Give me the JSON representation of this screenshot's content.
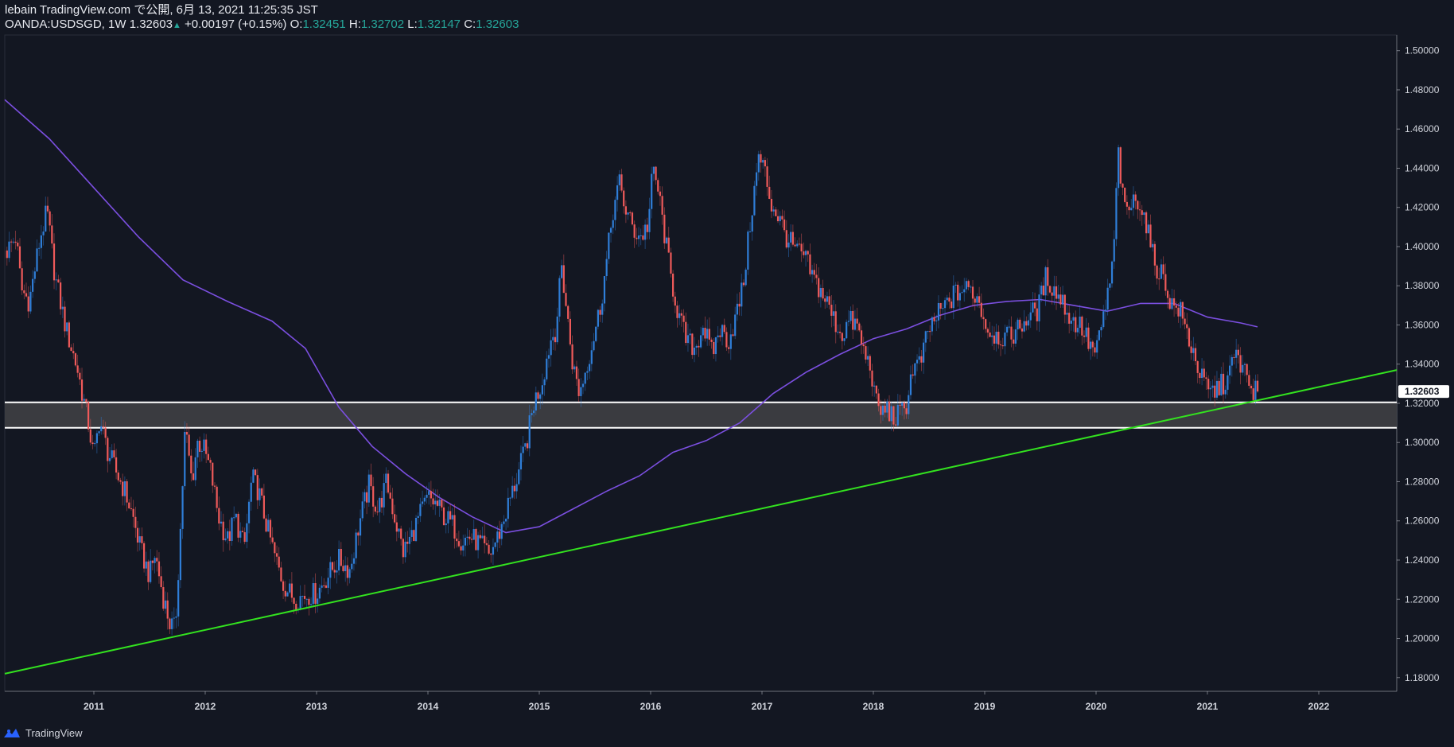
{
  "header": {
    "publish_line": "lebain TradingView.com で公開, 6月 13, 2021 11:25:35 JST",
    "symbol": "OANDA:USDSGD, 1W",
    "last": "1.32603",
    "change": "+0.00197 (+0.15%)",
    "o_label": "O:",
    "o": "1.32451",
    "h_label": "H:",
    "h": "1.32702",
    "l_label": "L:",
    "l": "1.32147",
    "c_label": "C:",
    "c": "1.32603"
  },
  "footer": {
    "brand": "TradingView",
    "icon": "tradingview-logo-icon"
  },
  "colors": {
    "background": "#131722",
    "up": "#2f7ed8",
    "down": "#ef5a5a",
    "ma": "#7b4fe0",
    "trendline": "#33e21f",
    "zone_fill": "#3a3b40",
    "zone_border": "#ffffff",
    "axis_text": "#d1d4dc",
    "price_label_bg": "#ffffff"
  },
  "chart_data": {
    "type": "candlestick",
    "symbol": "OANDA:USDSGD",
    "interval": "1W",
    "x_tick_labels": [
      "2011",
      "2012",
      "2013",
      "2014",
      "2015",
      "2016",
      "2017",
      "2018",
      "2019",
      "2020",
      "2021",
      "2022"
    ],
    "y_tick_labels": [
      "1.50000",
      "1.48000",
      "1.46000",
      "1.44000",
      "1.42000",
      "1.40000",
      "1.38000",
      "1.36000",
      "1.34000",
      "1.32000",
      "1.30000",
      "1.28000",
      "1.26000",
      "1.24000",
      "1.22000",
      "1.20000",
      "1.18000"
    ],
    "x_range": [
      2010.2,
      2022.7
    ],
    "y_range": [
      1.173,
      1.508
    ],
    "last_price_label": "1.32603",
    "last_price": 1.32603,
    "price_anchors": [
      [
        2010.22,
        1.398
      ],
      [
        2010.3,
        1.405
      ],
      [
        2010.35,
        1.378
      ],
      [
        2010.42,
        1.372
      ],
      [
        2010.52,
        1.405
      ],
      [
        2010.58,
        1.418
      ],
      [
        2010.65,
        1.385
      ],
      [
        2010.75,
        1.358
      ],
      [
        2010.85,
        1.338
      ],
      [
        2010.95,
        1.31
      ],
      [
        2011.0,
        1.292
      ],
      [
        2011.05,
        1.312
      ],
      [
        2011.12,
        1.296
      ],
      [
        2011.2,
        1.285
      ],
      [
        2011.28,
        1.275
      ],
      [
        2011.35,
        1.262
      ],
      [
        2011.42,
        1.245
      ],
      [
        2011.5,
        1.232
      ],
      [
        2011.55,
        1.243
      ],
      [
        2011.62,
        1.222
      ],
      [
        2011.68,
        1.208
      ],
      [
        2011.73,
        1.204
      ],
      [
        2011.78,
        1.258
      ],
      [
        2011.82,
        1.308
      ],
      [
        2011.88,
        1.28
      ],
      [
        2011.93,
        1.3
      ],
      [
        2011.98,
        1.298
      ],
      [
        2012.05,
        1.285
      ],
      [
        2012.12,
        1.262
      ],
      [
        2012.2,
        1.25
      ],
      [
        2012.27,
        1.262
      ],
      [
        2012.35,
        1.246
      ],
      [
        2012.42,
        1.282
      ],
      [
        2012.48,
        1.275
      ],
      [
        2012.55,
        1.258
      ],
      [
        2012.62,
        1.243
      ],
      [
        2012.7,
        1.228
      ],
      [
        2012.8,
        1.22
      ],
      [
        2012.9,
        1.222
      ],
      [
        2013.0,
        1.223
      ],
      [
        2013.1,
        1.232
      ],
      [
        2013.2,
        1.24
      ],
      [
        2013.3,
        1.235
      ],
      [
        2013.38,
        1.258
      ],
      [
        2013.47,
        1.278
      ],
      [
        2013.55,
        1.265
      ],
      [
        2013.63,
        1.28
      ],
      [
        2013.7,
        1.262
      ],
      [
        2013.78,
        1.244
      ],
      [
        2013.85,
        1.252
      ],
      [
        2013.92,
        1.262
      ],
      [
        2014.0,
        1.272
      ],
      [
        2014.08,
        1.268
      ],
      [
        2014.15,
        1.262
      ],
      [
        2014.22,
        1.258
      ],
      [
        2014.3,
        1.25
      ],
      [
        2014.38,
        1.252
      ],
      [
        2014.47,
        1.248
      ],
      [
        2014.55,
        1.242
      ],
      [
        2014.65,
        1.255
      ],
      [
        2014.72,
        1.268
      ],
      [
        2014.8,
        1.282
      ],
      [
        2014.88,
        1.298
      ],
      [
        2014.95,
        1.32
      ],
      [
        2015.02,
        1.33
      ],
      [
        2015.1,
        1.352
      ],
      [
        2015.15,
        1.358
      ],
      [
        2015.2,
        1.39
      ],
      [
        2015.25,
        1.365
      ],
      [
        2015.3,
        1.34
      ],
      [
        2015.36,
        1.325
      ],
      [
        2015.42,
        1.338
      ],
      [
        2015.48,
        1.352
      ],
      [
        2015.55,
        1.37
      ],
      [
        2015.6,
        1.39
      ],
      [
        2015.66,
        1.418
      ],
      [
        2015.72,
        1.432
      ],
      [
        2015.78,
        1.418
      ],
      [
        2015.85,
        1.408
      ],
      [
        2015.92,
        1.405
      ],
      [
        2015.98,
        1.412
      ],
      [
        2016.02,
        1.44
      ],
      [
        2016.07,
        1.428
      ],
      [
        2016.12,
        1.408
      ],
      [
        2016.18,
        1.385
      ],
      [
        2016.25,
        1.365
      ],
      [
        2016.32,
        1.352
      ],
      [
        2016.4,
        1.348
      ],
      [
        2016.47,
        1.36
      ],
      [
        2016.55,
        1.345
      ],
      [
        2016.62,
        1.358
      ],
      [
        2016.7,
        1.352
      ],
      [
        2016.77,
        1.365
      ],
      [
        2016.83,
        1.38
      ],
      [
        2016.9,
        1.415
      ],
      [
        2016.97,
        1.445
      ],
      [
        2017.02,
        1.44
      ],
      [
        2017.08,
        1.422
      ],
      [
        2017.15,
        1.415
      ],
      [
        2017.22,
        1.405
      ],
      [
        2017.3,
        1.398
      ],
      [
        2017.38,
        1.395
      ],
      [
        2017.45,
        1.385
      ],
      [
        2017.52,
        1.378
      ],
      [
        2017.58,
        1.372
      ],
      [
        2017.65,
        1.362
      ],
      [
        2017.72,
        1.355
      ],
      [
        2017.78,
        1.362
      ],
      [
        2017.85,
        1.36
      ],
      [
        2017.92,
        1.345
      ],
      [
        2017.98,
        1.338
      ],
      [
        2018.02,
        1.32
      ],
      [
        2018.08,
        1.315
      ],
      [
        2018.12,
        1.318
      ],
      [
        2018.18,
        1.312
      ],
      [
        2018.25,
        1.315
      ],
      [
        2018.3,
        1.32
      ],
      [
        2018.35,
        1.338
      ],
      [
        2018.42,
        1.34
      ],
      [
        2018.5,
        1.358
      ],
      [
        2018.58,
        1.365
      ],
      [
        2018.65,
        1.37
      ],
      [
        2018.72,
        1.375
      ],
      [
        2018.8,
        1.378
      ],
      [
        2018.88,
        1.378
      ],
      [
        2018.95,
        1.372
      ],
      [
        2019.02,
        1.358
      ],
      [
        2019.1,
        1.355
      ],
      [
        2019.2,
        1.353
      ],
      [
        2019.3,
        1.358
      ],
      [
        2019.4,
        1.365
      ],
      [
        2019.48,
        1.368
      ],
      [
        2019.55,
        1.385
      ],
      [
        2019.62,
        1.378
      ],
      [
        2019.7,
        1.372
      ],
      [
        2019.78,
        1.362
      ],
      [
        2019.86,
        1.36
      ],
      [
        2019.94,
        1.35
      ],
      [
        2020.0,
        1.345
      ],
      [
        2020.08,
        1.368
      ],
      [
        2020.15,
        1.39
      ],
      [
        2020.2,
        1.448
      ],
      [
        2020.25,
        1.418
      ],
      [
        2020.3,
        1.42
      ],
      [
        2020.38,
        1.425
      ],
      [
        2020.45,
        1.412
      ],
      [
        2020.52,
        1.392
      ],
      [
        2020.6,
        1.385
      ],
      [
        2020.68,
        1.37
      ],
      [
        2020.75,
        1.368
      ],
      [
        2020.82,
        1.355
      ],
      [
        2020.88,
        1.345
      ],
      [
        2020.95,
        1.332
      ],
      [
        2021.02,
        1.325
      ],
      [
        2021.1,
        1.328
      ],
      [
        2021.18,
        1.332
      ],
      [
        2021.25,
        1.345
      ],
      [
        2021.32,
        1.338
      ],
      [
        2021.38,
        1.328
      ],
      [
        2021.45,
        1.32603
      ]
    ],
    "ma": {
      "name": "",
      "points": [
        [
          2010.2,
          1.475
        ],
        [
          2010.6,
          1.455
        ],
        [
          2011.0,
          1.43
        ],
        [
          2011.4,
          1.405
        ],
        [
          2011.8,
          1.383
        ],
        [
          2012.2,
          1.372
        ],
        [
          2012.6,
          1.362
        ],
        [
          2012.9,
          1.348
        ],
        [
          2013.2,
          1.318
        ],
        [
          2013.5,
          1.298
        ],
        [
          2013.8,
          1.284
        ],
        [
          2014.1,
          1.272
        ],
        [
          2014.4,
          1.262
        ],
        [
          2014.7,
          1.254
        ],
        [
          2015.0,
          1.257
        ],
        [
          2015.3,
          1.266
        ],
        [
          2015.6,
          1.275
        ],
        [
          2015.9,
          1.283
        ],
        [
          2016.2,
          1.295
        ],
        [
          2016.5,
          1.301
        ],
        [
          2016.8,
          1.31
        ],
        [
          2017.1,
          1.325
        ],
        [
          2017.4,
          1.336
        ],
        [
          2017.7,
          1.345
        ],
        [
          2018.0,
          1.353
        ],
        [
          2018.3,
          1.358
        ],
        [
          2018.6,
          1.365
        ],
        [
          2018.9,
          1.37
        ],
        [
          2019.2,
          1.372
        ],
        [
          2019.5,
          1.373
        ],
        [
          2019.8,
          1.37
        ],
        [
          2020.1,
          1.367
        ],
        [
          2020.4,
          1.371
        ],
        [
          2020.7,
          1.371
        ],
        [
          2021.0,
          1.364
        ],
        [
          2021.3,
          1.361
        ],
        [
          2021.45,
          1.359
        ]
      ]
    },
    "trendline": {
      "from": [
        2010.2,
        1.182
      ],
      "to": [
        2022.7,
        1.337
      ]
    },
    "support_zone": {
      "upper": 1.3205,
      "lower": 1.3075
    }
  }
}
